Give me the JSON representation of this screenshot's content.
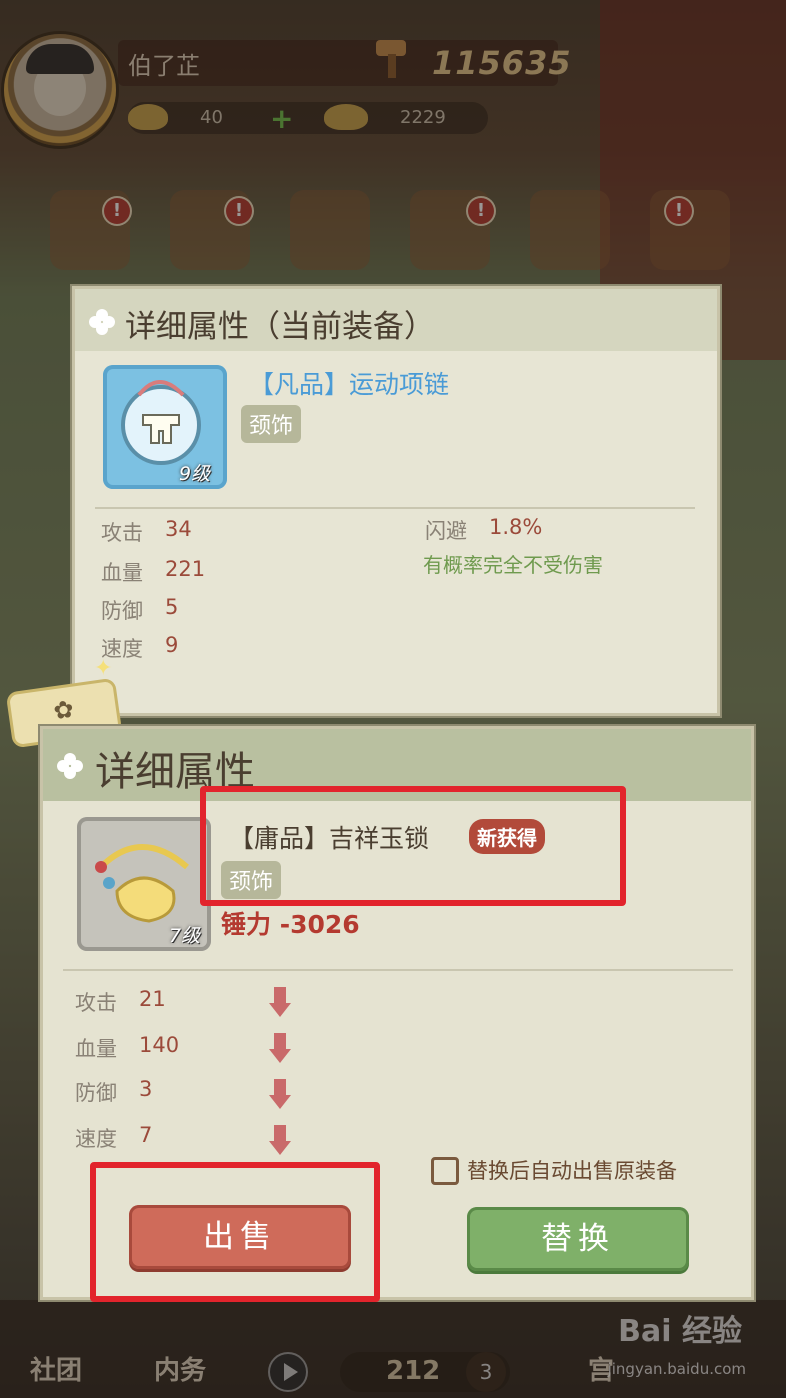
{
  "topbar": {
    "player_name": "伯了芷",
    "power": "115635",
    "gold": "40",
    "ingots": "2229"
  },
  "current_panel": {
    "title": "详细属性（当前装备）",
    "item": {
      "name": "【凡品】运动项链",
      "slot": "颈饰",
      "level": "9级"
    },
    "stats": [
      {
        "label": "攻击",
        "value": "34"
      },
      {
        "label": "血量",
        "value": "221"
      },
      {
        "label": "防御",
        "value": "5"
      },
      {
        "label": "速度",
        "value": "9"
      }
    ],
    "special": {
      "label": "闪避",
      "value": "1.8%",
      "effect": "有概率完全不受伤害"
    }
  },
  "new_panel": {
    "title": "详细属性",
    "item": {
      "name": "【庸品】吉祥玉锁",
      "badge": "新获得",
      "slot": "颈饰",
      "level": "7级",
      "power_change": "锤力 -3026"
    },
    "stats": [
      {
        "label": "攻击",
        "value": "21"
      },
      {
        "label": "血量",
        "value": "140"
      },
      {
        "label": "防御",
        "value": "3"
      },
      {
        "label": "速度",
        "value": "7"
      }
    ],
    "auto_sell_label": "替换后自动出售原装备",
    "sell_label": "出售",
    "replace_label": "替换"
  },
  "bottom_nav": {
    "left_label": "社团",
    "second_label": "内务",
    "coins": "212",
    "count": "3",
    "right_label": "宫"
  },
  "watermark": {
    "brand": "Bai 经验",
    "url": "jingyan.baidu.com"
  },
  "colors": {
    "sell": "#cf6b5a",
    "replace": "#7fb069",
    "highlight": "#e2242c",
    "power_loss": "#b43a30"
  }
}
